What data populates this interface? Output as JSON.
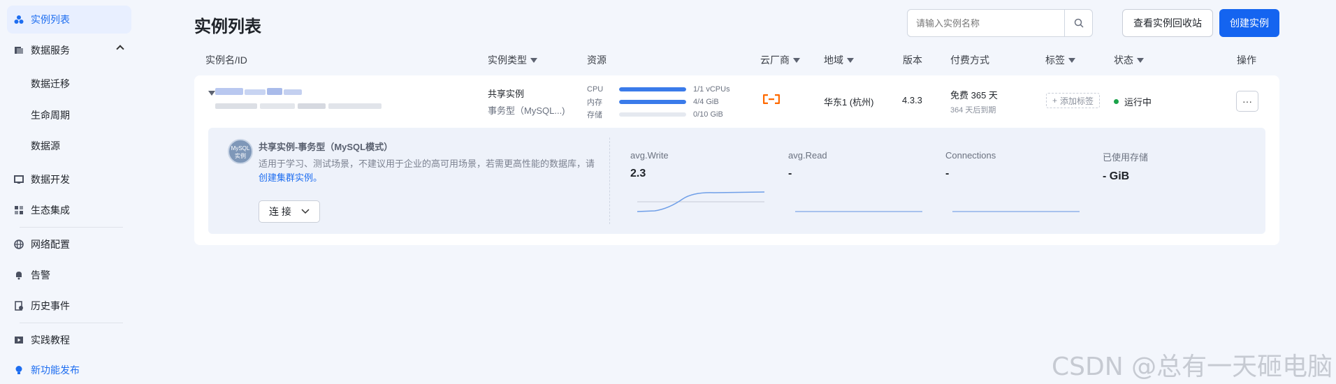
{
  "sidebar": {
    "items": [
      {
        "label": "实例列表",
        "icon": "cluster-icon",
        "active": true
      },
      {
        "label": "数据服务",
        "icon": "database-service-icon"
      },
      {
        "label": "数据迁移"
      },
      {
        "label": "生命周期"
      },
      {
        "label": "数据源"
      },
      {
        "label": "数据开发",
        "icon": "code-screen-icon"
      },
      {
        "label": "生态集成",
        "icon": "grid-apps-icon"
      },
      {
        "label": "网络配置",
        "icon": "globe-icon"
      },
      {
        "label": "告警",
        "icon": "bell-icon"
      },
      {
        "label": "历史事件",
        "icon": "history-doc-icon"
      },
      {
        "label": "实践教程",
        "icon": "video-play-icon"
      },
      {
        "label": "新功能发布",
        "icon": "lightbulb-icon"
      }
    ]
  },
  "header": {
    "title": "实例列表",
    "search_placeholder": "请输入实例名称",
    "recycle_label": "查看实例回收站",
    "create_label": "创建实例"
  },
  "table": {
    "columns": [
      "实例名/ID",
      "实例类型",
      "资源",
      "云厂商",
      "地域",
      "版本",
      "付费方式",
      "标签",
      "状态",
      "操作"
    ],
    "row": {
      "type_main": "共享实例",
      "type_sub": "事务型（MySQL...)",
      "resources": [
        {
          "label": "CPU",
          "value": "1/1 vCPUs",
          "fraction": 1.0
        },
        {
          "label": "内存",
          "value": "4/4 GiB",
          "fraction": 1.0
        },
        {
          "label": "存储",
          "value": "0/10 GiB",
          "fraction": 0.0
        }
      ],
      "region": "华东1 (杭州)",
      "version": "4.3.3",
      "pay_main": "免费 365 天",
      "pay_sub": "364 天后到期",
      "tag_button": "添加标签",
      "status": "运行中",
      "more": "···"
    }
  },
  "detail": {
    "badge_top": "MySQL",
    "badge_bottom": "实例",
    "title": "共享实例-事务型（MySQL模式）",
    "desc_text": "适用于学习、测试场景，不建议用于企业的高可用场景，若需更高性能的数据库，请",
    "desc_link": "创建集群实例。",
    "connect_label": "连 接",
    "metrics": [
      {
        "label": "avg.Write",
        "value": "2.3"
      },
      {
        "label": "avg.Read",
        "value": "-"
      },
      {
        "label": "Connections",
        "value": "-"
      },
      {
        "label": "已使用存储",
        "value": "- GiB"
      }
    ]
  },
  "watermark": "CSDN @总有一天砸电脑",
  "colors": {
    "accent": "#1464f0",
    "status_green": "#1aa34a",
    "cloud_orange": "#ff6a00"
  }
}
